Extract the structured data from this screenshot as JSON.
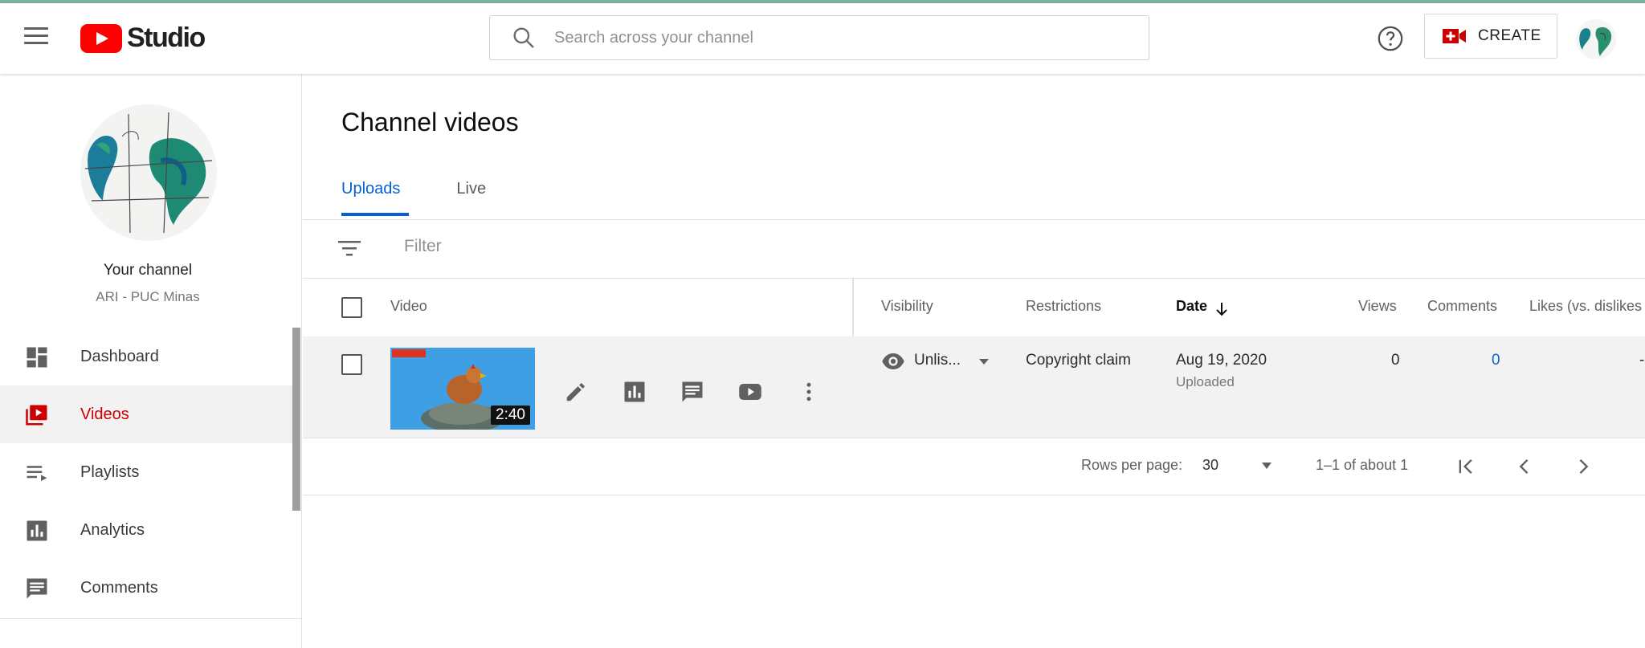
{
  "header": {
    "app_name": "Studio",
    "search_placeholder": "Search across your channel",
    "create_label": "CREATE"
  },
  "sidebar": {
    "channel_title": "Your channel",
    "channel_name": "ARI - PUC Minas",
    "items": [
      {
        "label": "Dashboard",
        "icon": "dashboard-icon"
      },
      {
        "label": "Videos",
        "icon": "videos-icon",
        "active": true
      },
      {
        "label": "Playlists",
        "icon": "playlists-icon"
      },
      {
        "label": "Analytics",
        "icon": "analytics-icon"
      },
      {
        "label": "Comments",
        "icon": "comments-icon"
      }
    ]
  },
  "main": {
    "title": "Channel videos",
    "tabs": [
      {
        "label": "Uploads",
        "active": true
      },
      {
        "label": "Live",
        "active": false
      }
    ],
    "filter_placeholder": "Filter",
    "columns": {
      "video": "Video",
      "visibility": "Visibility",
      "restrictions": "Restrictions",
      "date": "Date",
      "views": "Views",
      "comments": "Comments",
      "likes": "Likes (vs. dislikes"
    },
    "rows": [
      {
        "duration": "2:40",
        "visibility": "Unlis...",
        "restriction": "Copyright claim",
        "date": "Aug 19, 2020",
        "date_status": "Uploaded",
        "views": "0",
        "comments": "0",
        "likes": "-"
      }
    ],
    "pagination": {
      "rows_per_page_label": "Rows per page:",
      "rows_per_page": "30",
      "range": "1–1 of about 1"
    }
  },
  "colors": {
    "accent_blue": "#065fd4",
    "active_red": "#cc0000",
    "brand_red": "#ff0000",
    "top_stripe": "#7bb0a3"
  }
}
